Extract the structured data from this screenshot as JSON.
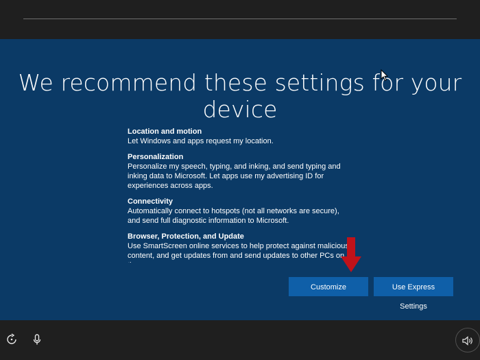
{
  "page": {
    "heading": "We recommend these settings for your device"
  },
  "settings": [
    {
      "title": "Location and motion",
      "description": "Let Windows and apps request my location."
    },
    {
      "title": "Personalization",
      "description": "Personalize my speech, typing, and inking, and send typing and inking data to Microsoft. Let apps use my advertising ID for experiences across apps."
    },
    {
      "title": "Connectivity",
      "description": "Automatically connect to hotspots (not all networks are secure), and send full diagnostic information to Microsoft."
    },
    {
      "title": "Browser, Protection, and Update",
      "description": "Use SmartScreen online services to help protect against malicious content, and get updates from and send updates to other PCs on the"
    }
  ],
  "buttons": {
    "customize": "Customize",
    "express": "Use Express Settings"
  },
  "icons": {
    "ease_of_access": "ease-of-access-icon",
    "microphone": "microphone-icon",
    "volume": "volume-icon",
    "cursor": "mouse-cursor-icon",
    "arrow": "red-down-arrow-icon"
  },
  "colors": {
    "panel_background": "#0b3a66",
    "frame_background": "#1f1f1f",
    "button_background": "#0f5fa8",
    "annotation_arrow": "#c0121a"
  }
}
